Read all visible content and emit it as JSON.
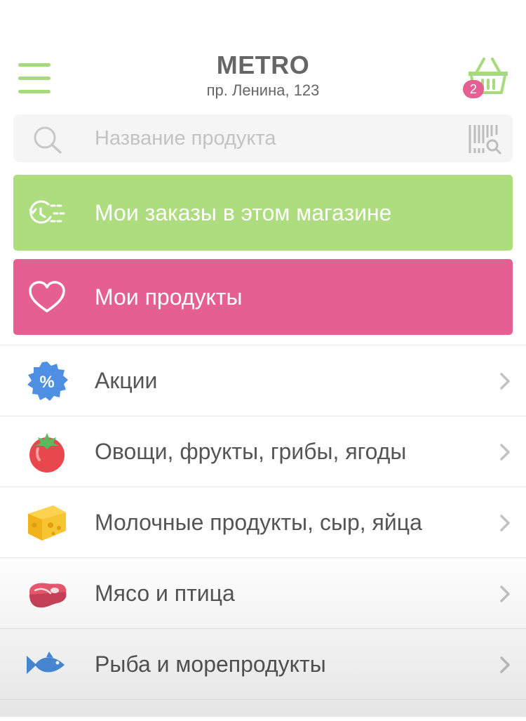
{
  "header": {
    "title": "METRO",
    "address": "пр. Ленина, 123",
    "menu_icon": "hamburger-menu-icon",
    "cart_icon": "basket-icon",
    "cart_count": "2"
  },
  "search": {
    "placeholder": "Название продукта",
    "value": "",
    "search_icon": "search-icon",
    "barcode_icon": "barcode-scan-icon"
  },
  "actions": {
    "orders_label": "Мои заказы в этом магазине",
    "orders_icon": "order-history-icon",
    "favorites_label": "Мои продукты",
    "favorites_icon": "heart-icon"
  },
  "categories": [
    {
      "label": "Акции",
      "icon": "discount-badge-icon"
    },
    {
      "label": "Овощи, фрукты, грибы, ягоды",
      "icon": "tomato-icon"
    },
    {
      "label": "Молочные продукты, сыр, яйца",
      "icon": "cheese-icon"
    },
    {
      "label": "Мясо и птица",
      "icon": "steak-icon"
    },
    {
      "label": "Рыба и морепродукты",
      "icon": "fish-icon"
    }
  ],
  "colors": {
    "accent_green": "#addd7e",
    "accent_pink": "#e65f93",
    "text": "#555555"
  }
}
